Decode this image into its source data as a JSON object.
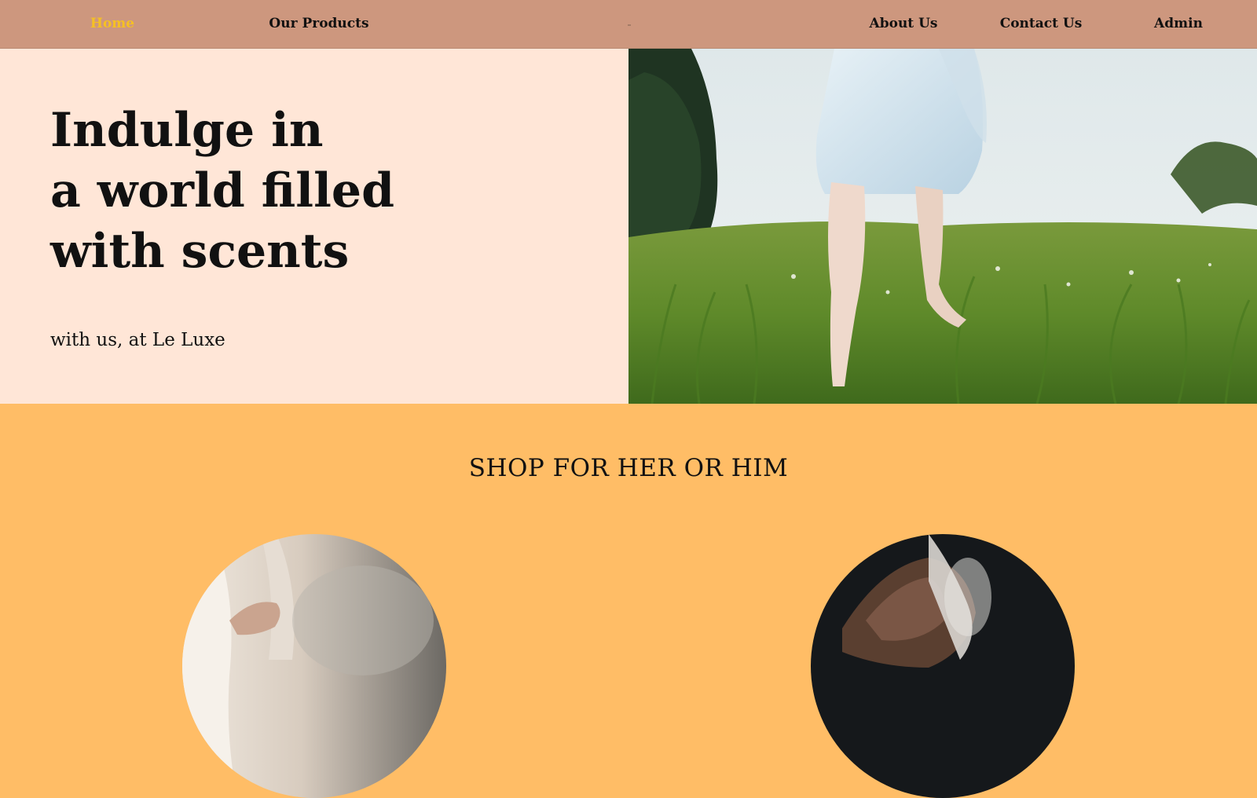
{
  "nav": {
    "items": [
      {
        "label": "Home",
        "active": true
      },
      {
        "label": "Our Products",
        "active": false
      },
      {
        "label": "About Us",
        "active": false
      },
      {
        "label": "Contact Us",
        "active": false
      },
      {
        "label": "Admin",
        "active": false
      }
    ]
  },
  "hero": {
    "title_lines": [
      "Indulge in",
      "a world filled",
      "with scents"
    ],
    "subtitle": "with us, at Le Luxe",
    "image": "girl-running-in-meadow"
  },
  "shop": {
    "title": "SHOP FOR HER OR HIM",
    "categories": [
      {
        "image": "her-perfume-photo"
      },
      {
        "image": "him-perfume-photo"
      }
    ]
  },
  "colors": {
    "nav_bg": "#cd977e",
    "nav_active": "#f5c023",
    "hero_bg": "#ffe6d7",
    "shop_bg": "#ffbd66",
    "text": "#111111"
  }
}
